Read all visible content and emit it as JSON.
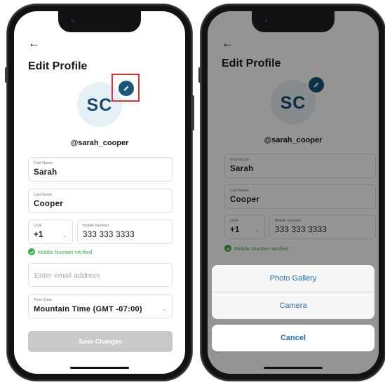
{
  "profile": {
    "back_icon": "arrow-left-icon",
    "title": "Edit Profile",
    "initials": "SC",
    "username": "@sarah_cooper",
    "first_name": {
      "label": "First Name",
      "value": "Sarah"
    },
    "last_name": {
      "label": "Last Name",
      "value": "Cooper"
    },
    "country": {
      "label": "USA",
      "code": "+1"
    },
    "mobile": {
      "label": "Mobile Number",
      "value": "333 333 3333"
    },
    "verified_text": "Mobile Number verified",
    "email": {
      "placeholder": "Enter email address"
    },
    "timezone": {
      "label": "Time Zone",
      "value": "Mountain Time (GMT -07:00)"
    },
    "save_label": "Save Changes"
  },
  "action_sheet": {
    "options": [
      "Photo Gallery",
      "Camera"
    ],
    "cancel_label": "Cancel"
  },
  "colors": {
    "accent": "#1b5577",
    "avatar_bg": "#e6f0f7",
    "verified": "#3aaa47",
    "highlight": "#d9363e",
    "sheet_text": "#2a6da3",
    "disabled_button": "#c9c9c9"
  }
}
